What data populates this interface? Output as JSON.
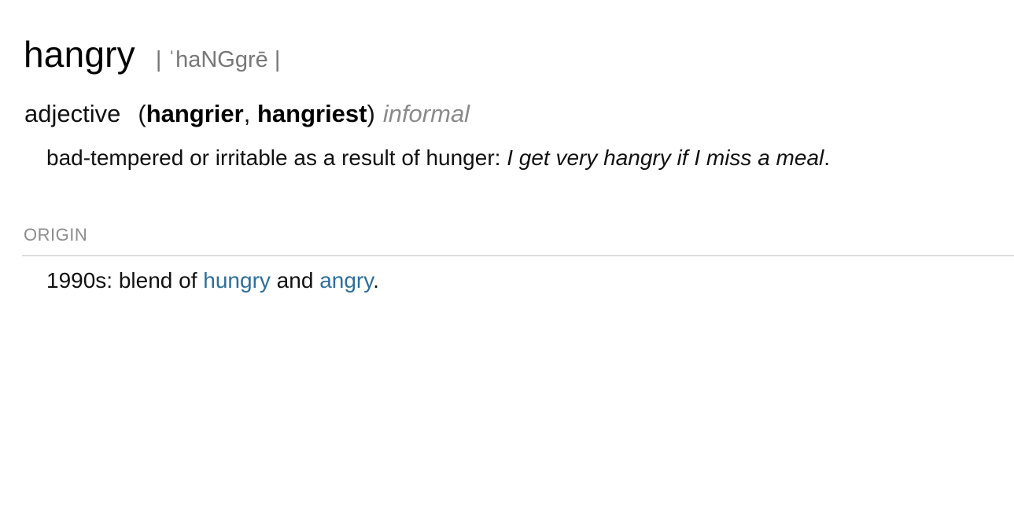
{
  "entry": {
    "headword": "hangry",
    "pronunciation": "| ˈhaNGgrē |",
    "part_of_speech": "adjective",
    "inflections": {
      "open_paren": "(",
      "comparative": "hangrier",
      "separator": ", ",
      "superlative": "hangriest",
      "close_paren": ")"
    },
    "register": "informal",
    "definition": {
      "text": "bad-tempered or irritable as a result of hunger: ",
      "example": "I get very hangry if I miss a meal",
      "end": "."
    },
    "origin": {
      "header": "ORIGIN",
      "prefix": "1990s: blend of ",
      "link1": "hungry",
      "middle": " and ",
      "link2": "angry",
      "end": "."
    }
  },
  "colors": {
    "link": "#2f6f9a",
    "muted": "#8a8a8a",
    "rule": "#dddddd"
  }
}
